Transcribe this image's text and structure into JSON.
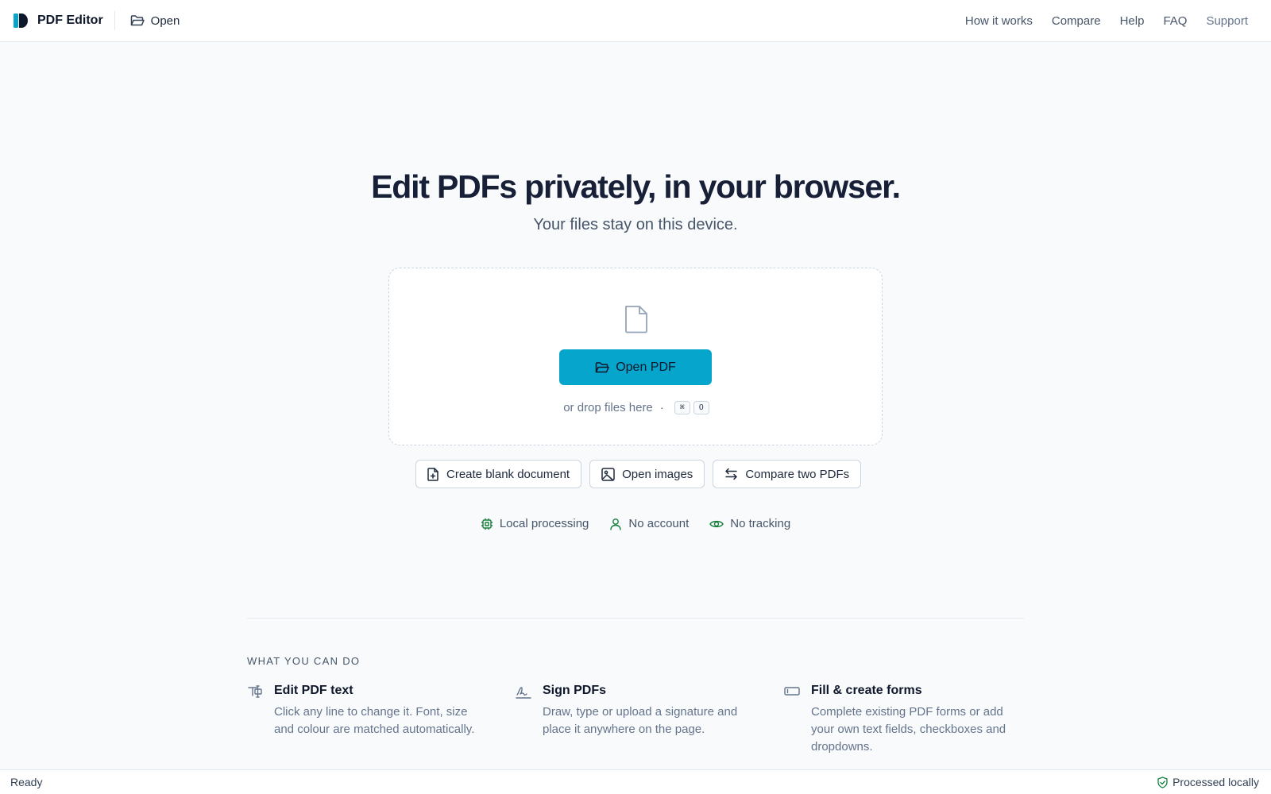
{
  "header": {
    "app_name": "PDF Editor",
    "open_label": "Open",
    "nav": [
      "How it works",
      "Compare",
      "Help",
      "FAQ",
      "Support"
    ]
  },
  "hero": {
    "title": "Edit PDFs privately, in your browser.",
    "subtitle": "Your files stay on this device."
  },
  "dropzone": {
    "open_button": "Open PDF",
    "hint": "or drop files here",
    "separator": "·",
    "shortcut_keys": [
      "⌘",
      "O"
    ]
  },
  "actions": [
    {
      "label": "Create blank document",
      "icon": "file-plus-icon"
    },
    {
      "label": "Open images",
      "icon": "image-icon"
    },
    {
      "label": "Compare two PDFs",
      "icon": "swap-arrows-icon"
    }
  ],
  "trust": [
    {
      "label": "Local processing",
      "icon": "chip-icon"
    },
    {
      "label": "No account",
      "icon": "user-icon"
    },
    {
      "label": "No tracking",
      "icon": "eye-icon"
    }
  ],
  "features_section": {
    "label": "WHAT YOU CAN DO",
    "items": [
      {
        "title": "Edit PDF text",
        "desc": "Click any line to change it. Font, size and colour are matched automatically.",
        "icon": "text-cursor-icon"
      },
      {
        "title": "Sign PDFs",
        "desc": "Draw, type or upload a signature and place it anywhere on the page.",
        "icon": "signature-icon"
      },
      {
        "title": "Fill & create forms",
        "desc": "Complete existing PDF forms or add your own text fields, checkboxes and dropdowns.",
        "icon": "form-field-icon"
      }
    ]
  },
  "status": {
    "left": "Ready",
    "right": "Processed locally"
  },
  "colors": {
    "accent": "#06a5cc",
    "trust_icon": "#15803d",
    "logo": "#0e7490"
  }
}
